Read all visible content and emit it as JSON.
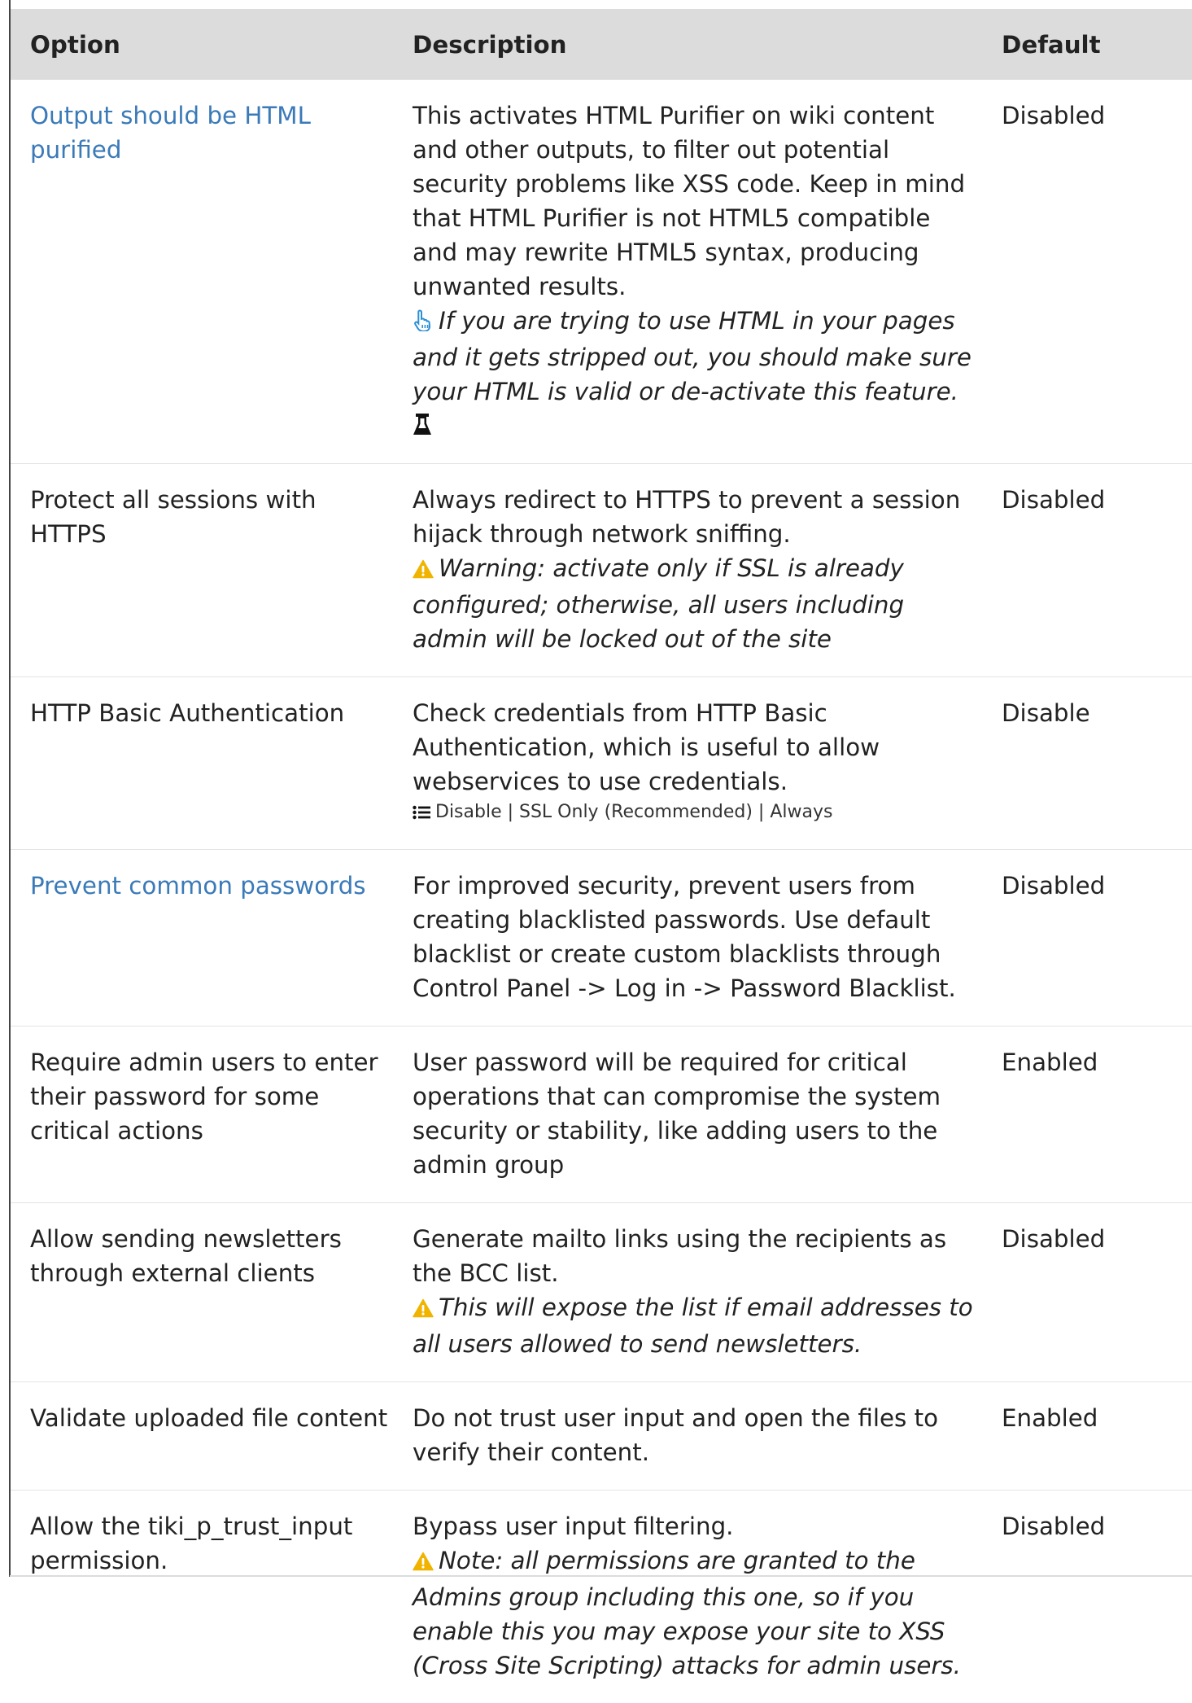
{
  "table": {
    "headers": {
      "option": "Option",
      "description": "Description",
      "default": "Default"
    },
    "rows": [
      {
        "option": "Output should be HTML purified",
        "option_is_link": true,
        "description": "This activates HTML Purifier on wiki content and other outputs, to filter out potential security problems like XSS code. Keep in mind that HTML Purifier is not HTML5 compatible and may rewrite HTML5 syntax, producing unwanted results.",
        "note_icon": "pointing-hand-icon",
        "note": "If you are trying to use HTML in your pages and it gets stripped out, you should make sure your HTML is valid or de-activate this feature.",
        "extra_icon": "flask-icon",
        "default": "Disabled"
      },
      {
        "option": "Protect all sessions with HTTPS",
        "option_is_link": false,
        "description": "Always redirect to HTTPS to prevent a session hijack through network sniffing.",
        "note_icon": "warning-icon",
        "note": "Warning: activate only if SSL is already configured; otherwise, all users including admin will be locked out of the site",
        "default": "Disabled"
      },
      {
        "option": "HTTP Basic Authentication",
        "option_is_link": false,
        "description": "Check credentials from HTTP Basic Authentication, which is useful to allow webservices to use credentials.",
        "options_icon": "list-icon",
        "options": "Disable | SSL Only (Recommended) | Always",
        "default": "Disable"
      },
      {
        "option": "Prevent common passwords",
        "option_is_link": true,
        "description": "For improved security, prevent users from creating blacklisted passwords. Use default blacklist or create custom blacklists through Control Panel -> Log in -> Password Blacklist.",
        "default": "Disabled"
      },
      {
        "option": "Require admin users to enter their password for some critical actions",
        "option_is_link": false,
        "description": "User password will be required for critical operations that can compromise the system security or stability, like adding users to the admin group",
        "default": "Enabled"
      },
      {
        "option": "Allow sending newsletters through external clients",
        "option_is_link": false,
        "description": "Generate mailto links using the recipients as the BCC list.",
        "note_icon": "warning-icon",
        "note": "This will expose the list if email addresses to all users allowed to send newsletters.",
        "default": "Disabled"
      },
      {
        "option": "Validate uploaded file content",
        "option_is_link": false,
        "description": "Do not trust user input and open the files to verify their content.",
        "default": "Enabled"
      },
      {
        "option": "Allow the tiki_p_trust_input permission.",
        "option_is_link": false,
        "description": "Bypass user input filtering.",
        "note_icon": "warning-icon",
        "note": "Note: all permissions are granted to the Admins group including this one, so if you enable this you may expose your site to XSS (Cross Site Scripting) attacks for admin users.",
        "default": "Disabled"
      }
    ]
  },
  "colors": {
    "link": "#3a7ab8",
    "header_bg": "#dcdcdc",
    "warning": "#f0b400",
    "hand": "#2b8fd6"
  }
}
